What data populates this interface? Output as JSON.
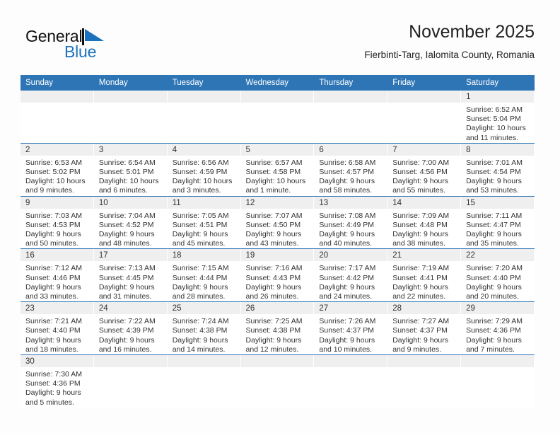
{
  "logo": {
    "text_primary": "General",
    "text_secondary": "Blue",
    "flag_icon": "blue-flag-triangle-icon",
    "primary_color": "#111111",
    "accent_color": "#1c72bd"
  },
  "header": {
    "title": "November 2025",
    "subtitle": "Fierbinti-Targ, Ialomita County, Romania"
  },
  "theme": {
    "header_bg": "#2e75b6",
    "header_text": "#ffffff",
    "daynum_band_bg": "#efefef",
    "cell_bg": "#ffffff",
    "row_divider": "#2e75b6",
    "body_text": "#333333"
  },
  "calendar": {
    "weekday_headers": [
      "Sunday",
      "Monday",
      "Tuesday",
      "Wednesday",
      "Thursday",
      "Friday",
      "Saturday"
    ],
    "labels": {
      "sunrise_prefix": "Sunrise:",
      "sunset_prefix": "Sunset:",
      "daylight_prefix": "Daylight:"
    },
    "weeks": [
      [
        {
          "day": "",
          "blank": true
        },
        {
          "day": "",
          "blank": true
        },
        {
          "day": "",
          "blank": true
        },
        {
          "day": "",
          "blank": true
        },
        {
          "day": "",
          "blank": true
        },
        {
          "day": "",
          "blank": true
        },
        {
          "day": "1",
          "sunrise": "Sunrise: 6:52 AM",
          "sunset": "Sunset: 5:04 PM",
          "daylight_line1": "Daylight: 10 hours",
          "daylight_line2": "and 11 minutes."
        }
      ],
      [
        {
          "day": "2",
          "sunrise": "Sunrise: 6:53 AM",
          "sunset": "Sunset: 5:02 PM",
          "daylight_line1": "Daylight: 10 hours",
          "daylight_line2": "and 9 minutes."
        },
        {
          "day": "3",
          "sunrise": "Sunrise: 6:54 AM",
          "sunset": "Sunset: 5:01 PM",
          "daylight_line1": "Daylight: 10 hours",
          "daylight_line2": "and 6 minutes."
        },
        {
          "day": "4",
          "sunrise": "Sunrise: 6:56 AM",
          "sunset": "Sunset: 4:59 PM",
          "daylight_line1": "Daylight: 10 hours",
          "daylight_line2": "and 3 minutes."
        },
        {
          "day": "5",
          "sunrise": "Sunrise: 6:57 AM",
          "sunset": "Sunset: 4:58 PM",
          "daylight_line1": "Daylight: 10 hours",
          "daylight_line2": "and 1 minute."
        },
        {
          "day": "6",
          "sunrise": "Sunrise: 6:58 AM",
          "sunset": "Sunset: 4:57 PM",
          "daylight_line1": "Daylight: 9 hours",
          "daylight_line2": "and 58 minutes."
        },
        {
          "day": "7",
          "sunrise": "Sunrise: 7:00 AM",
          "sunset": "Sunset: 4:56 PM",
          "daylight_line1": "Daylight: 9 hours",
          "daylight_line2": "and 55 minutes."
        },
        {
          "day": "8",
          "sunrise": "Sunrise: 7:01 AM",
          "sunset": "Sunset: 4:54 PM",
          "daylight_line1": "Daylight: 9 hours",
          "daylight_line2": "and 53 minutes."
        }
      ],
      [
        {
          "day": "9",
          "sunrise": "Sunrise: 7:03 AM",
          "sunset": "Sunset: 4:53 PM",
          "daylight_line1": "Daylight: 9 hours",
          "daylight_line2": "and 50 minutes."
        },
        {
          "day": "10",
          "sunrise": "Sunrise: 7:04 AM",
          "sunset": "Sunset: 4:52 PM",
          "daylight_line1": "Daylight: 9 hours",
          "daylight_line2": "and 48 minutes."
        },
        {
          "day": "11",
          "sunrise": "Sunrise: 7:05 AM",
          "sunset": "Sunset: 4:51 PM",
          "daylight_line1": "Daylight: 9 hours",
          "daylight_line2": "and 45 minutes."
        },
        {
          "day": "12",
          "sunrise": "Sunrise: 7:07 AM",
          "sunset": "Sunset: 4:50 PM",
          "daylight_line1": "Daylight: 9 hours",
          "daylight_line2": "and 43 minutes."
        },
        {
          "day": "13",
          "sunrise": "Sunrise: 7:08 AM",
          "sunset": "Sunset: 4:49 PM",
          "daylight_line1": "Daylight: 9 hours",
          "daylight_line2": "and 40 minutes."
        },
        {
          "day": "14",
          "sunrise": "Sunrise: 7:09 AM",
          "sunset": "Sunset: 4:48 PM",
          "daylight_line1": "Daylight: 9 hours",
          "daylight_line2": "and 38 minutes."
        },
        {
          "day": "15",
          "sunrise": "Sunrise: 7:11 AM",
          "sunset": "Sunset: 4:47 PM",
          "daylight_line1": "Daylight: 9 hours",
          "daylight_line2": "and 35 minutes."
        }
      ],
      [
        {
          "day": "16",
          "sunrise": "Sunrise: 7:12 AM",
          "sunset": "Sunset: 4:46 PM",
          "daylight_line1": "Daylight: 9 hours",
          "daylight_line2": "and 33 minutes."
        },
        {
          "day": "17",
          "sunrise": "Sunrise: 7:13 AM",
          "sunset": "Sunset: 4:45 PM",
          "daylight_line1": "Daylight: 9 hours",
          "daylight_line2": "and 31 minutes."
        },
        {
          "day": "18",
          "sunrise": "Sunrise: 7:15 AM",
          "sunset": "Sunset: 4:44 PM",
          "daylight_line1": "Daylight: 9 hours",
          "daylight_line2": "and 28 minutes."
        },
        {
          "day": "19",
          "sunrise": "Sunrise: 7:16 AM",
          "sunset": "Sunset: 4:43 PM",
          "daylight_line1": "Daylight: 9 hours",
          "daylight_line2": "and 26 minutes."
        },
        {
          "day": "20",
          "sunrise": "Sunrise: 7:17 AM",
          "sunset": "Sunset: 4:42 PM",
          "daylight_line1": "Daylight: 9 hours",
          "daylight_line2": "and 24 minutes."
        },
        {
          "day": "21",
          "sunrise": "Sunrise: 7:19 AM",
          "sunset": "Sunset: 4:41 PM",
          "daylight_line1": "Daylight: 9 hours",
          "daylight_line2": "and 22 minutes."
        },
        {
          "day": "22",
          "sunrise": "Sunrise: 7:20 AM",
          "sunset": "Sunset: 4:40 PM",
          "daylight_line1": "Daylight: 9 hours",
          "daylight_line2": "and 20 minutes."
        }
      ],
      [
        {
          "day": "23",
          "sunrise": "Sunrise: 7:21 AM",
          "sunset": "Sunset: 4:40 PM",
          "daylight_line1": "Daylight: 9 hours",
          "daylight_line2": "and 18 minutes."
        },
        {
          "day": "24",
          "sunrise": "Sunrise: 7:22 AM",
          "sunset": "Sunset: 4:39 PM",
          "daylight_line1": "Daylight: 9 hours",
          "daylight_line2": "and 16 minutes."
        },
        {
          "day": "25",
          "sunrise": "Sunrise: 7:24 AM",
          "sunset": "Sunset: 4:38 PM",
          "daylight_line1": "Daylight: 9 hours",
          "daylight_line2": "and 14 minutes."
        },
        {
          "day": "26",
          "sunrise": "Sunrise: 7:25 AM",
          "sunset": "Sunset: 4:38 PM",
          "daylight_line1": "Daylight: 9 hours",
          "daylight_line2": "and 12 minutes."
        },
        {
          "day": "27",
          "sunrise": "Sunrise: 7:26 AM",
          "sunset": "Sunset: 4:37 PM",
          "daylight_line1": "Daylight: 9 hours",
          "daylight_line2": "and 10 minutes."
        },
        {
          "day": "28",
          "sunrise": "Sunrise: 7:27 AM",
          "sunset": "Sunset: 4:37 PM",
          "daylight_line1": "Daylight: 9 hours",
          "daylight_line2": "and 9 minutes."
        },
        {
          "day": "29",
          "sunrise": "Sunrise: 7:29 AM",
          "sunset": "Sunset: 4:36 PM",
          "daylight_line1": "Daylight: 9 hours",
          "daylight_line2": "and 7 minutes."
        }
      ],
      [
        {
          "day": "30",
          "sunrise": "Sunrise: 7:30 AM",
          "sunset": "Sunset: 4:36 PM",
          "daylight_line1": "Daylight: 9 hours",
          "daylight_line2": "and 5 minutes."
        },
        {
          "day": "",
          "blank": true
        },
        {
          "day": "",
          "blank": true
        },
        {
          "day": "",
          "blank": true
        },
        {
          "day": "",
          "blank": true
        },
        {
          "day": "",
          "blank": true
        },
        {
          "day": "",
          "blank": true
        }
      ]
    ]
  }
}
